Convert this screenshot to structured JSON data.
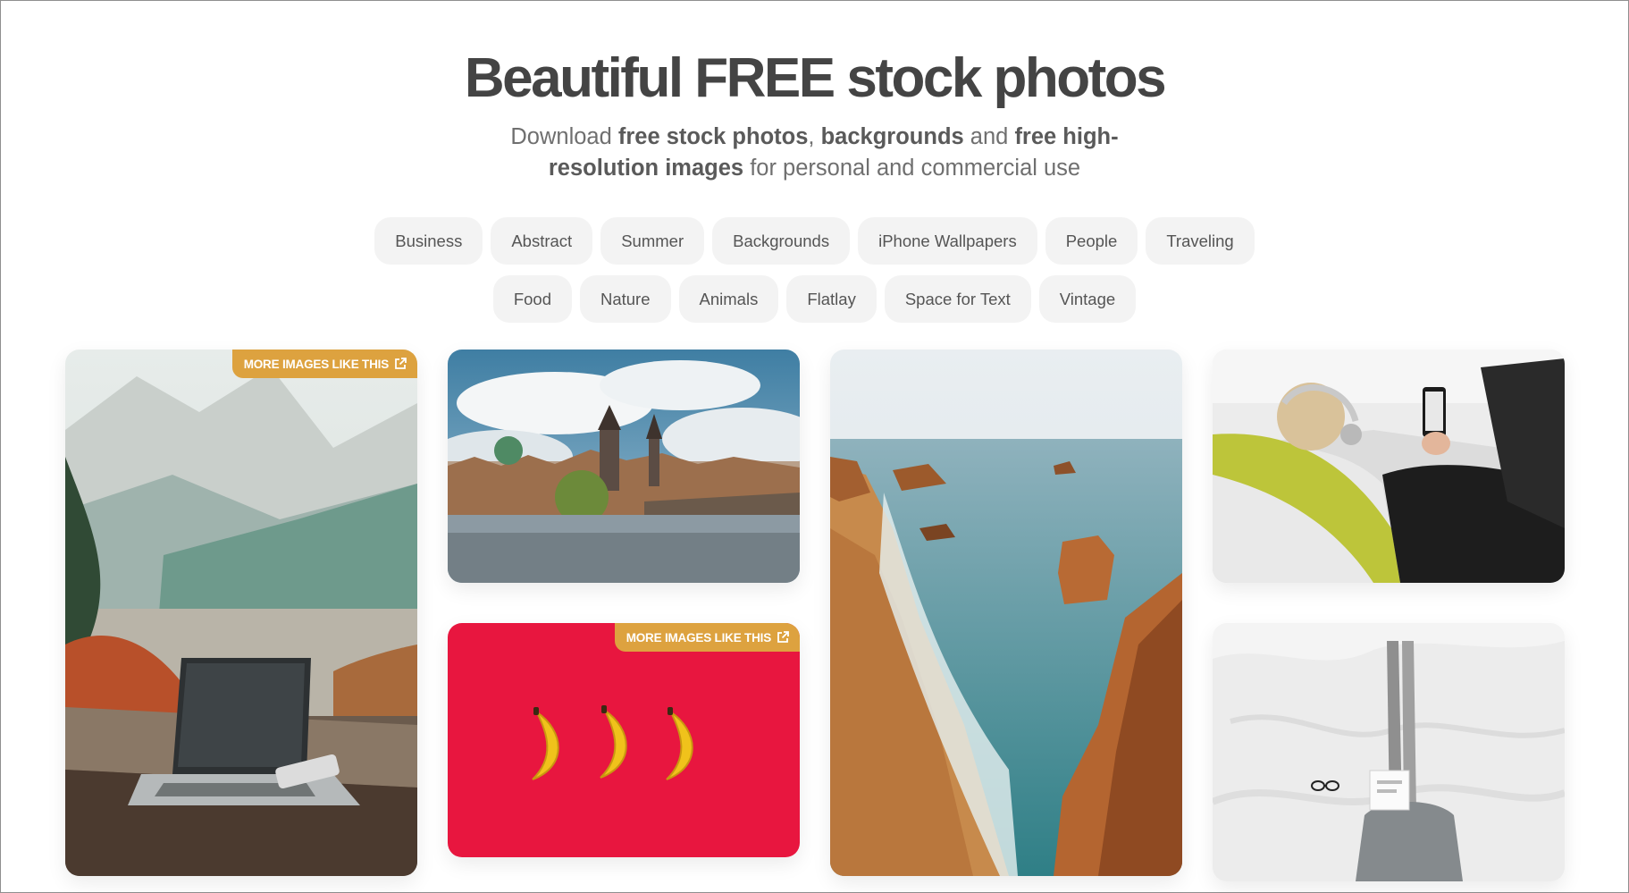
{
  "hero": {
    "title": "Beautiful FREE stock photos",
    "subtitle": {
      "download": "Download ",
      "free_stock_photos": "free stock photos",
      "comma": ", ",
      "backgrounds": "backgrounds",
      "and": " and ",
      "free_high_res": "free high-resolution images",
      "tail": " for personal and commercial use"
    }
  },
  "tags": {
    "row1": [
      "Business",
      "Abstract",
      "Summer",
      "Backgrounds",
      "iPhone Wallpapers",
      "People",
      "Traveling"
    ],
    "row2": [
      "Food",
      "Nature",
      "Animals",
      "Flatlay",
      "Space for Text",
      "Vintage"
    ]
  },
  "gallery": {
    "more_label": "MORE IMAGES LIKE THIS",
    "photos": [
      {
        "subject": "laptop on wooden railing with mountain valley",
        "has_more_button": true
      },
      {
        "subject": "prague charles bridge under cloudy sky",
        "has_more_button": false
      },
      {
        "subject": "three bananas on red background",
        "has_more_button": true
      },
      {
        "subject": "aerial beach with sea rocks",
        "has_more_button": false
      },
      {
        "subject": "woman with headphones on sofa using phone",
        "has_more_button": false
      },
      {
        "subject": "reading a book in white bed",
        "has_more_button": false
      }
    ]
  },
  "colors": {
    "accent_gold": "#dda23f",
    "tag_bg": "#f3f3f3",
    "title_text": "#444444",
    "banana_red": "#e8163f"
  }
}
